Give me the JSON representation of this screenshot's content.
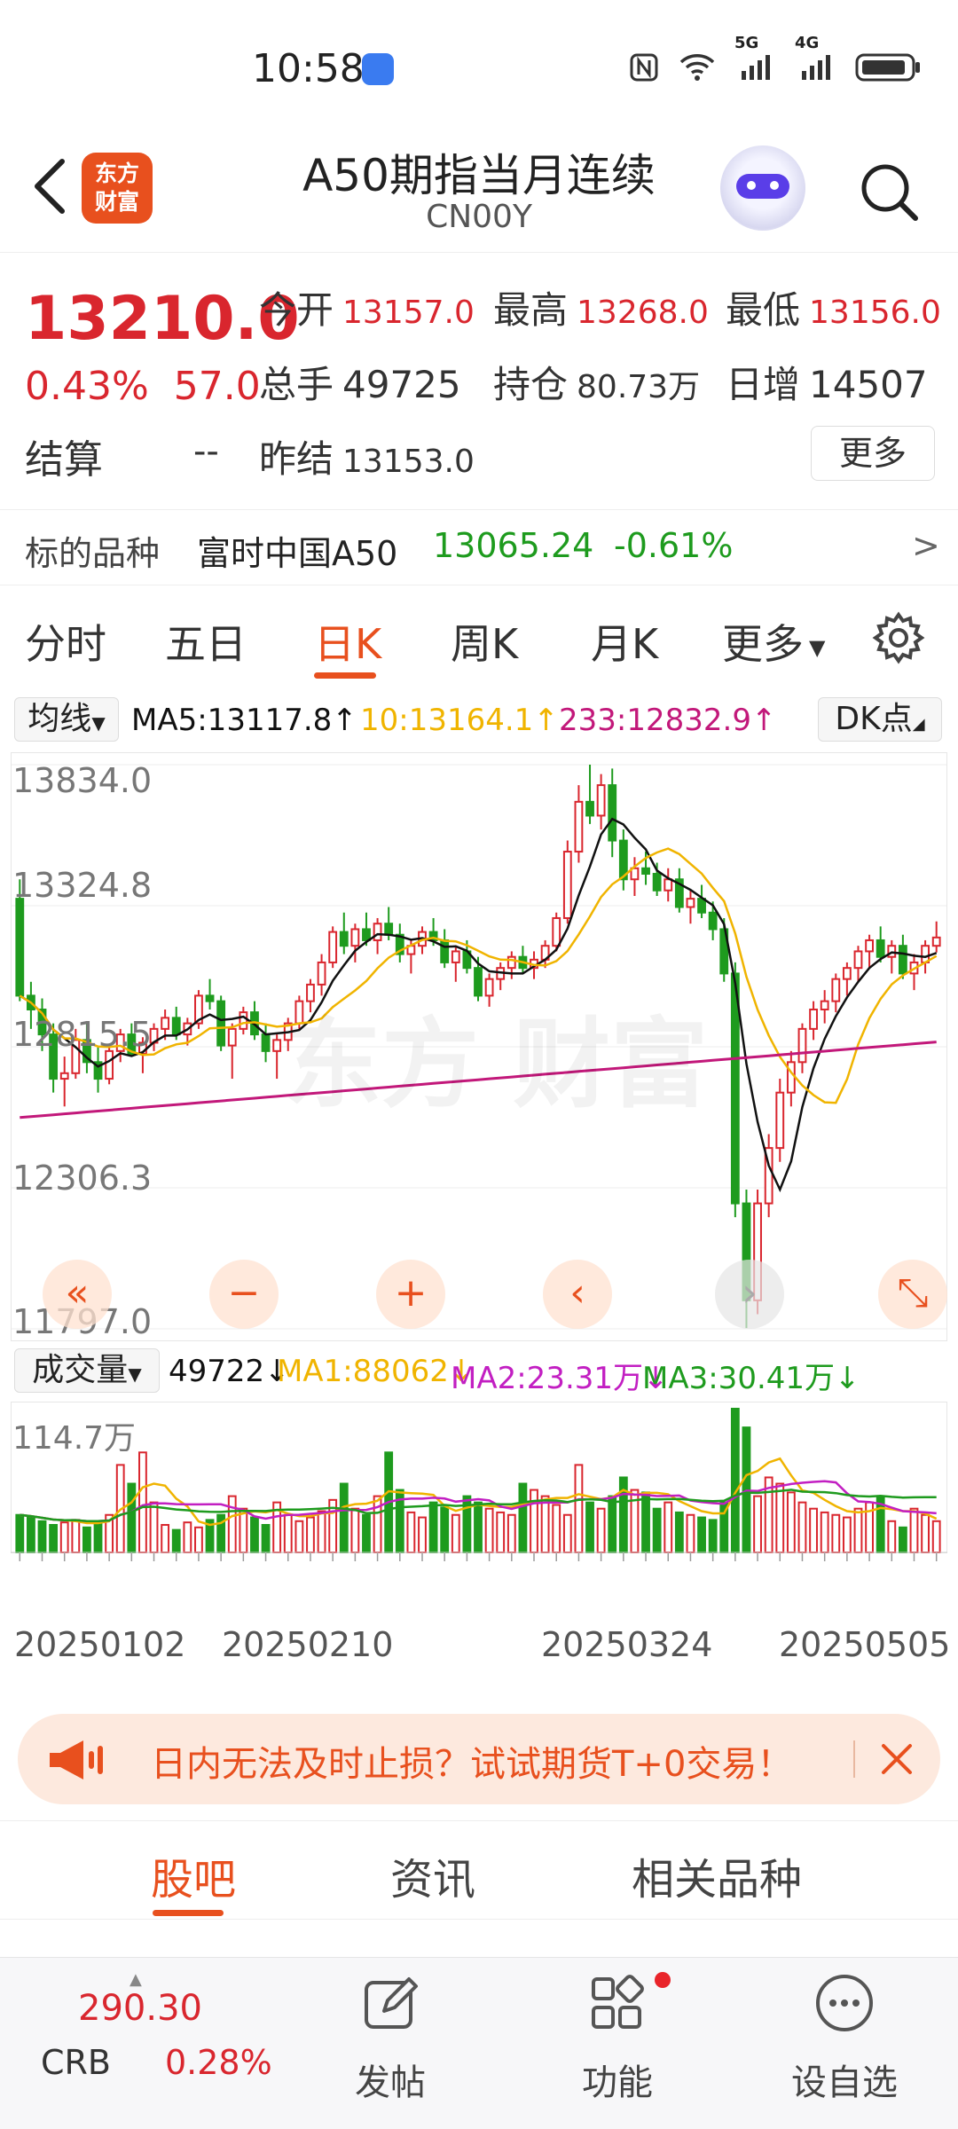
{
  "status_bar": {
    "time": "10:58",
    "signal_5g": "5G",
    "signal_4g": "4G"
  },
  "header": {
    "logo_text": "东方\n财富",
    "title": "A50期指当月连续",
    "code": "CN00Y"
  },
  "quote": {
    "price": "13210.0",
    "change_pct": "0.43%",
    "change_abs": "57.0",
    "open_label": "今开",
    "open_value": "13157.0",
    "high_label": "最高",
    "high_value": "13268.0",
    "low_label": "最低",
    "low_value": "13156.0",
    "volume_label": "总手",
    "volume_value": "49725",
    "oi_label": "持仓",
    "oi_value": "80.73万",
    "daily_inc_label": "日增",
    "daily_inc_value": "14507",
    "settle_label": "结算",
    "settle_value": "--",
    "prev_settle_label": "昨结",
    "prev_settle_value": "13153.0",
    "more_label": "更多"
  },
  "underlying": {
    "label": "标的品种",
    "name": "富时中国A50",
    "price": "13065.24",
    "change": "-0.61%",
    "arrow": ">"
  },
  "period_tabs": {
    "items": [
      "分时",
      "五日",
      "日K",
      "周K",
      "月K",
      "更多"
    ],
    "active": "日K"
  },
  "ma_bar": {
    "selector": "均线",
    "ma5": "MA5:13117.8↑",
    "ma10": "10:13164.1↑",
    "ma233": "233:12832.9↑",
    "dk_button": "DK点"
  },
  "price_axis": {
    "labels": [
      "13834.0",
      "13324.8",
      "12815.5",
      "12306.3",
      "11797.0"
    ]
  },
  "volume_bar": {
    "selector": "成交量",
    "current": "49722↓",
    "ma1": "MA1:88062↓",
    "ma2": "MA2:23.31万↓",
    "ma3": "MA3:30.41万↓",
    "max_label": "114.7万"
  },
  "date_axis": {
    "labels": [
      "20250102",
      "20250210",
      "20250324",
      "20250505"
    ]
  },
  "chart_controls": {
    "rewind": "«",
    "zoom_out": "−",
    "zoom_in": "+",
    "prev": "‹",
    "next": "›",
    "fullscreen": "⤡"
  },
  "colors": {
    "up": "#d9262e",
    "down": "#1e9b1e",
    "accent": "#e8501e",
    "ma5": "#111111",
    "ma10": "#f0b400",
    "ma233": "#c2187a"
  },
  "chart_data": {
    "type": "candlestick",
    "ylim": [
      11797.0,
      13834.0
    ],
    "x_ticks": [
      "20250102",
      "20250210",
      "20250324",
      "20250505"
    ],
    "series": [
      {
        "name": "MA5",
        "value": 13117.8
      },
      {
        "name": "MA10",
        "value": 13164.1
      },
      {
        "name": "MA233",
        "value": 12832.9
      }
    ],
    "ohlc": [
      [
        13350,
        13420,
        12980,
        13000
      ],
      [
        13000,
        13050,
        12880,
        12950
      ],
      [
        12950,
        12990,
        12800,
        12860
      ],
      [
        12860,
        12900,
        12650,
        12700
      ],
      [
        12700,
        12780,
        12600,
        12720
      ],
      [
        12720,
        12880,
        12700,
        12840
      ],
      [
        12840,
        12900,
        12720,
        12760
      ],
      [
        12760,
        12820,
        12650,
        12700
      ],
      [
        12700,
        12820,
        12680,
        12800
      ],
      [
        12800,
        12880,
        12760,
        12860
      ],
      [
        12860,
        12900,
        12780,
        12790
      ],
      [
        12790,
        12850,
        12720,
        12830
      ],
      [
        12830,
        12900,
        12800,
        12880
      ],
      [
        12880,
        12950,
        12840,
        12920
      ],
      [
        12920,
        12960,
        12840,
        12860
      ],
      [
        12860,
        12920,
        12820,
        12900
      ],
      [
        12900,
        13020,
        12880,
        13000
      ],
      [
        13000,
        13060,
        12950,
        12980
      ],
      [
        12980,
        13000,
        12800,
        12820
      ],
      [
        12820,
        12900,
        12700,
        12880
      ],
      [
        12880,
        12960,
        12860,
        12940
      ],
      [
        12940,
        12980,
        12840,
        12860
      ],
      [
        12860,
        12900,
        12760,
        12800
      ],
      [
        12800,
        12860,
        12700,
        12840
      ],
      [
        12840,
        12920,
        12800,
        12900
      ],
      [
        12900,
        13000,
        12880,
        12980
      ],
      [
        12980,
        13060,
        12940,
        13040
      ],
      [
        13040,
        13150,
        13000,
        13120
      ],
      [
        13120,
        13250,
        13100,
        13230
      ],
      [
        13230,
        13300,
        13150,
        13180
      ],
      [
        13180,
        13260,
        13120,
        13240
      ],
      [
        13240,
        13300,
        13180,
        13200
      ],
      [
        13200,
        13280,
        13150,
        13260
      ],
      [
        13260,
        13320,
        13200,
        13220
      ],
      [
        13220,
        13260,
        13120,
        13150
      ],
      [
        13150,
        13200,
        13080,
        13180
      ],
      [
        13180,
        13250,
        13150,
        13230
      ],
      [
        13230,
        13280,
        13180,
        13200
      ],
      [
        13200,
        13240,
        13100,
        13120
      ],
      [
        13120,
        13180,
        13050,
        13160
      ],
      [
        13160,
        13200,
        13080,
        13100
      ],
      [
        13100,
        13140,
        12980,
        13000
      ],
      [
        13000,
        13080,
        12960,
        13060
      ],
      [
        13060,
        13120,
        13020,
        13100
      ],
      [
        13100,
        13160,
        13060,
        13140
      ],
      [
        13140,
        13180,
        13080,
        13100
      ],
      [
        13100,
        13160,
        13060,
        13130
      ],
      [
        13130,
        13200,
        13100,
        13180
      ],
      [
        13180,
        13300,
        13160,
        13280
      ],
      [
        13280,
        13560,
        13260,
        13520
      ],
      [
        13520,
        13760,
        13480,
        13700
      ],
      [
        13700,
        13834,
        13620,
        13650
      ],
      [
        13650,
        13800,
        13600,
        13760
      ],
      [
        13760,
        13820,
        13500,
        13560
      ],
      [
        13560,
        13600,
        13380,
        13420
      ],
      [
        13420,
        13500,
        13360,
        13460
      ],
      [
        13460,
        13520,
        13400,
        13440
      ],
      [
        13440,
        13480,
        13360,
        13380
      ],
      [
        13380,
        13460,
        13340,
        13420
      ],
      [
        13420,
        13460,
        13300,
        13320
      ],
      [
        13320,
        13380,
        13260,
        13350
      ],
      [
        13350,
        13400,
        13280,
        13300
      ],
      [
        13300,
        13340,
        13200,
        13240
      ],
      [
        13240,
        13280,
        13050,
        13080
      ],
      [
        13080,
        13120,
        12200,
        12250
      ],
      [
        12250,
        12300,
        11800,
        11900
      ],
      [
        11900,
        12300,
        11850,
        12250
      ],
      [
        12250,
        12500,
        12200,
        12450
      ],
      [
        12450,
        12700,
        12400,
        12650
      ],
      [
        12650,
        12800,
        12600,
        12760
      ],
      [
        12760,
        12900,
        12720,
        12880
      ],
      [
        12880,
        12980,
        12840,
        12950
      ],
      [
        12950,
        13020,
        12900,
        12980
      ],
      [
        12980,
        13080,
        12940,
        13060
      ],
      [
        13060,
        13120,
        13000,
        13100
      ],
      [
        13100,
        13180,
        13050,
        13160
      ],
      [
        13160,
        13220,
        13100,
        13200
      ],
      [
        13200,
        13250,
        13120,
        13140
      ],
      [
        13140,
        13200,
        13080,
        13180
      ],
      [
        13180,
        13220,
        13060,
        13080
      ],
      [
        13080,
        13150,
        13020,
        13120
      ],
      [
        13120,
        13200,
        13080,
        13180
      ],
      [
        13180,
        13268,
        13156,
        13210
      ]
    ],
    "volume": [
      30,
      28,
      25,
      22,
      24,
      26,
      20,
      25,
      30,
      70,
      55,
      80,
      40,
      22,
      18,
      24,
      20,
      26,
      30,
      45,
      35,
      28,
      22,
      40,
      30,
      25,
      28,
      33,
      42,
      55,
      35,
      30,
      45,
      80,
      50,
      32,
      28,
      40,
      36,
      30,
      45,
      40,
      35,
      32,
      30,
      55,
      50,
      45,
      38,
      30,
      70,
      40,
      35,
      45,
      60,
      50,
      48,
      35,
      40,
      32,
      30,
      28,
      26,
      40,
      115,
      100,
      45,
      60,
      55,
      48,
      40,
      35,
      32,
      30,
      28,
      35,
      40,
      45,
      25,
      20,
      35,
      30,
      25
    ]
  }
}
